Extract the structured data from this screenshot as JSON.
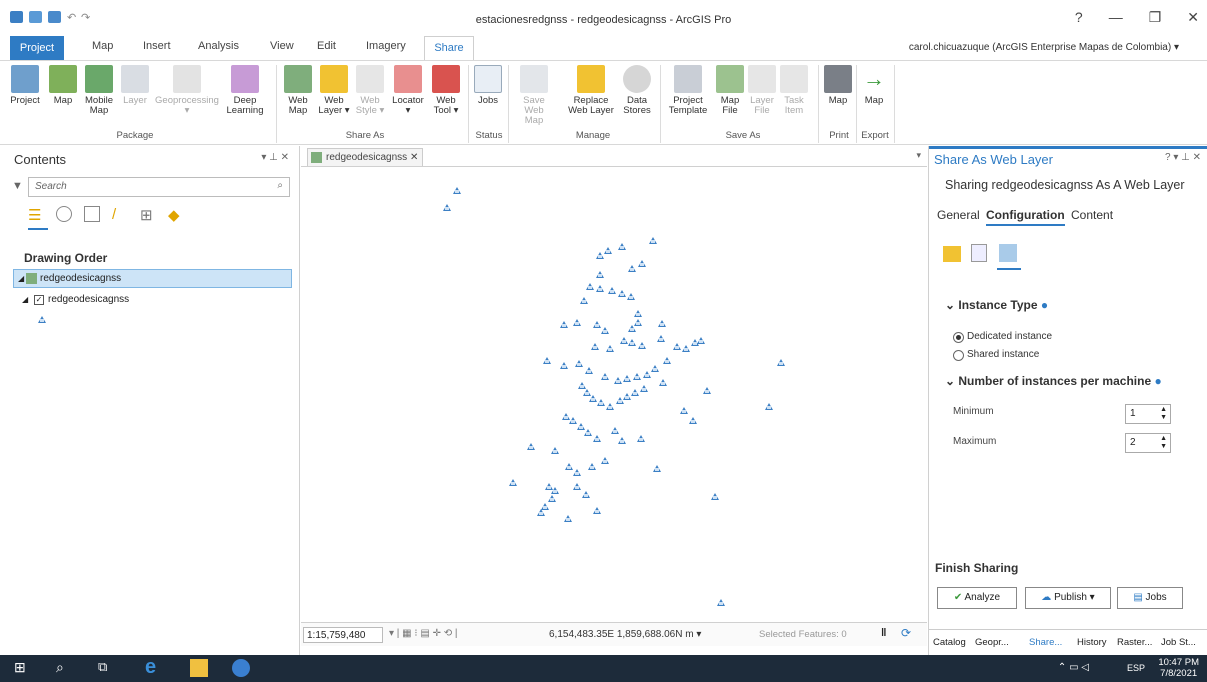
{
  "window": {
    "title": "estacionesredgnss - redgeodesicagnss - ArcGIS Pro"
  },
  "tabs": [
    "Project",
    "Map",
    "Insert",
    "Analysis",
    "View",
    "Edit",
    "Imagery",
    "Share"
  ],
  "account": "carol.chicuazuque (ArcGIS Enterprise Mapas de Colombia) ▾",
  "ribbon": {
    "buttons": [
      {
        "label": "Project",
        "sub": ""
      },
      {
        "label": "Map",
        "sub": ""
      },
      {
        "label": "Mobile",
        "sub": "Map"
      },
      {
        "label": "Layer",
        "sub": ""
      },
      {
        "label": "Geoprocessing",
        "sub": "▾"
      },
      {
        "label": "Deep",
        "sub": "Learning"
      },
      {
        "label": "Web",
        "sub": "Map"
      },
      {
        "label": "Web",
        "sub": "Layer ▾"
      },
      {
        "label": "Web",
        "sub": "Style ▾"
      },
      {
        "label": "Locator",
        "sub": "▾"
      },
      {
        "label": "Web",
        "sub": "Tool ▾"
      },
      {
        "label": "Jobs",
        "sub": ""
      },
      {
        "label": "Save Web",
        "sub": "Map"
      },
      {
        "label": "Replace",
        "sub": "Web Layer"
      },
      {
        "label": "Data",
        "sub": "Stores"
      },
      {
        "label": "Project",
        "sub": "Template"
      },
      {
        "label": "Map",
        "sub": "File"
      },
      {
        "label": "Layer",
        "sub": "File"
      },
      {
        "label": "Task",
        "sub": "Item"
      },
      {
        "label": "Map",
        "sub": ""
      },
      {
        "label": "Map",
        "sub": ""
      }
    ],
    "groups": [
      "Package",
      "Share As",
      "Status",
      "Manage",
      "Save As",
      "Print",
      "Export"
    ]
  },
  "contents": {
    "title": "Contents",
    "search_placeholder": "Search",
    "drawing_order": "Drawing Order",
    "map_item": "redgeodesicagnss",
    "layer_item": "redgeodesicagnss"
  },
  "map": {
    "tab": "redgeodesicagnss ✕",
    "scale": "1:15,759,480",
    "coords": "6,154,483.35E 1,859,688.06N m ▾",
    "selected": "Selected Features: 0"
  },
  "share": {
    "title": "Share As Web Layer",
    "subtitle": "Sharing redgeodesicagnss As A Web Layer",
    "tabs": [
      "General",
      "Configuration",
      "Content"
    ],
    "instance_type": "Instance Type",
    "dedicated": "Dedicated instance",
    "shared": "Shared instance",
    "instances_per_machine": "Number of instances per machine",
    "minimum_label": "Minimum",
    "minimum_value": "1",
    "maximum_label": "Maximum",
    "maximum_value": "2",
    "finish": "Finish Sharing",
    "analyze": "Analyze",
    "publish": "Publish",
    "jobs": "Jobs",
    "bottom_tabs": [
      "Catalog",
      "Geopr...",
      "Share...",
      "History",
      "Raster...",
      "Job St..."
    ]
  },
  "taskbar": {
    "time": "10:47 PM",
    "date": "7/8/2021",
    "lang": "ESP"
  },
  "colors": {
    "accent": "#2e7bc4",
    "point": "#3b7fc4",
    "taskbar": "#1d2b3a"
  }
}
